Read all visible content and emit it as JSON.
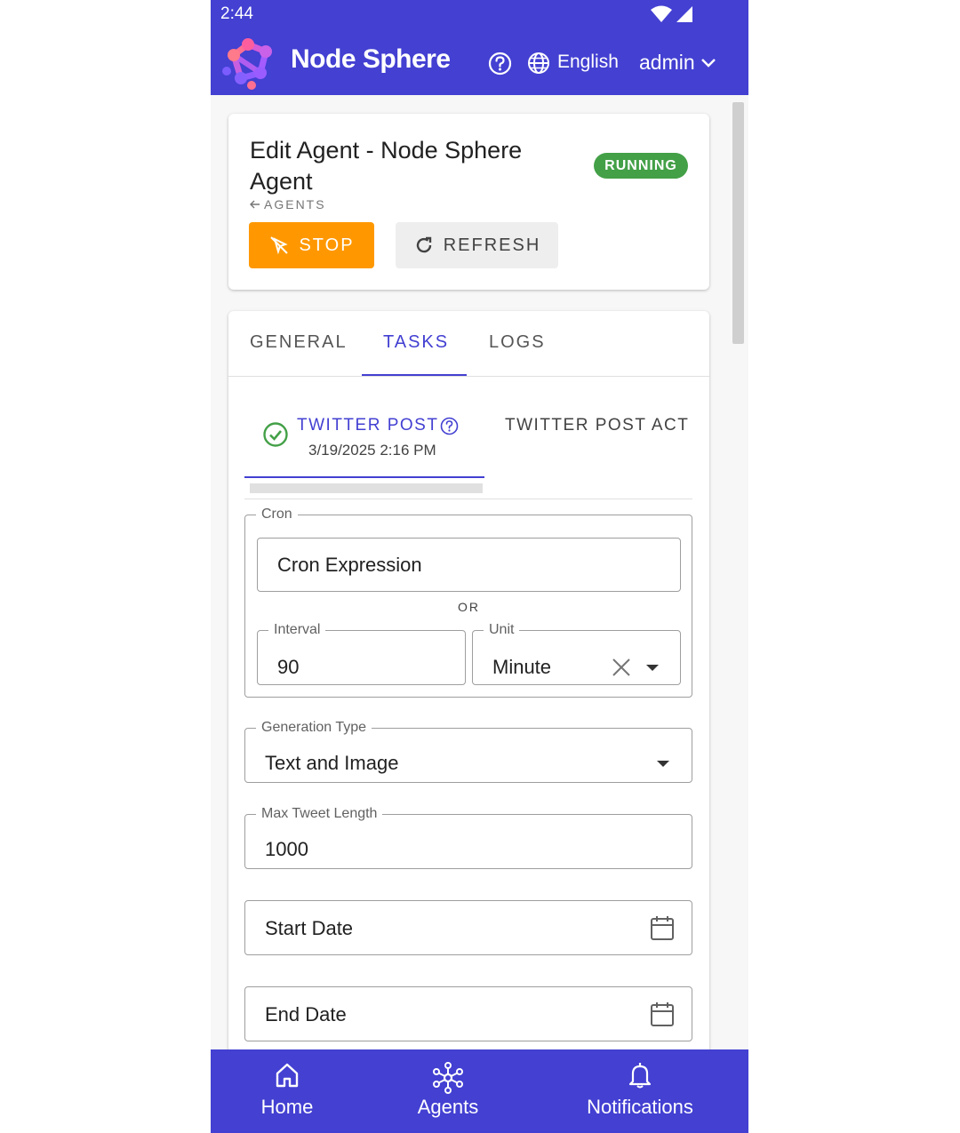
{
  "status_bar": {
    "time": "2:44"
  },
  "header": {
    "brand": "Node Sphere",
    "language": "English",
    "user": "admin"
  },
  "agent": {
    "title": "Edit Agent - Node Sphere Agent",
    "status": "RUNNING",
    "back_label": "AGENTS",
    "stop_label": "STOP",
    "refresh_label": "REFRESH"
  },
  "tabs": [
    {
      "label": "GENERAL",
      "active": false
    },
    {
      "label": "TASKS",
      "active": true
    },
    {
      "label": "LOGS",
      "active": false
    }
  ],
  "task_tabs": [
    {
      "label": "TWITTER POST",
      "date": "3/19/2025 2:16 PM",
      "active": true
    },
    {
      "label": "TWITTER POST ACT",
      "active": false
    }
  ],
  "form": {
    "cron_legend": "Cron",
    "cron_placeholder": "Cron Expression",
    "or_label": "OR",
    "interval_label": "Interval",
    "interval_value": "90",
    "unit_label": "Unit",
    "unit_value": "Minute",
    "generation_type_label": "Generation Type",
    "generation_type_value": "Text and Image",
    "max_tweet_length_label": "Max Tweet Length",
    "max_tweet_length_value": "1000",
    "start_date_placeholder": "Start Date",
    "end_date_placeholder": "End Date"
  },
  "bottom_nav": [
    {
      "label": "Home",
      "icon": "home-icon"
    },
    {
      "label": "Agents",
      "icon": "agents-network-icon"
    },
    {
      "label": "Notifications",
      "icon": "bell-icon"
    }
  ],
  "colors": {
    "primary": "#4340d2",
    "running": "#43a047",
    "stop": "#ff9800"
  }
}
